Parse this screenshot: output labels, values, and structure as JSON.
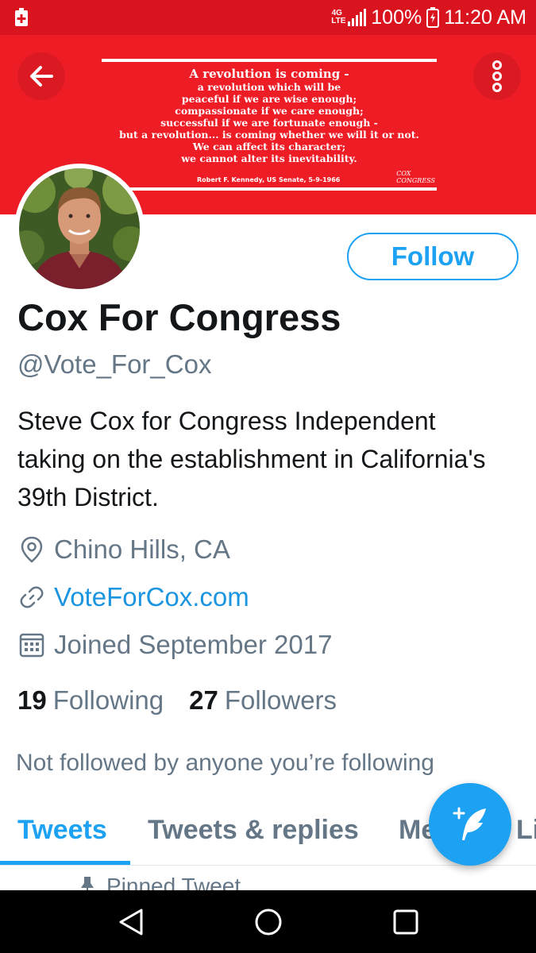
{
  "status_bar": {
    "network": "4G LTE",
    "battery": "100%",
    "time": "11:20 AM",
    "notification_icon": "first-aid-icon",
    "background": "#d9141e"
  },
  "header": {
    "back_icon": "back-arrow-icon",
    "more_icon": "more-vertical-icon",
    "banner_color": "#ee1c25",
    "banner_quote": {
      "lines": [
        "A revolution is coming -",
        "a revolution which will be",
        "peaceful if we are wise enough;",
        "compassionate if we care enough;",
        "successful if we are fortunate enough -",
        "but a revolution... is coming whether we will it or not.",
        "We can affect its character;",
        "we cannot alter its inevitability."
      ],
      "attribution": "Robert F. Kennedy, US Senate, 5-9-1966",
      "logo_top": "COX",
      "logo_bottom": "CONGRESS"
    }
  },
  "profile": {
    "display_name": "Cox For Congress",
    "handle": "@Vote_For_Cox",
    "bio": "Steve Cox for Congress Independent taking on the establishment in California's 39th District.",
    "location": "Chino Hills, CA",
    "url": "VoteForCox.com",
    "joined": "Joined September 2017",
    "follow_label": "Follow",
    "following_count": "19",
    "following_label": "Following",
    "followers_count": "27",
    "followers_label": "Followers",
    "not_followed_text": "Not followed by anyone you’re following"
  },
  "tabs": [
    {
      "label": "Tweets",
      "active": true
    },
    {
      "label": "Tweets & replies",
      "active": false
    },
    {
      "label": "Media",
      "active": false
    },
    {
      "label": "Likes",
      "active": false
    }
  ],
  "pinned": {
    "label": "Pinned Tweet"
  },
  "fab": {
    "icon": "compose-tweet-icon"
  },
  "nav_bar": {
    "back": "nav-back-icon",
    "home": "nav-home-icon",
    "recents": "nav-recents-icon"
  },
  "colors": {
    "accent": "#1da1f2",
    "secondary_text": "#657786",
    "link": "#1b95e0"
  }
}
